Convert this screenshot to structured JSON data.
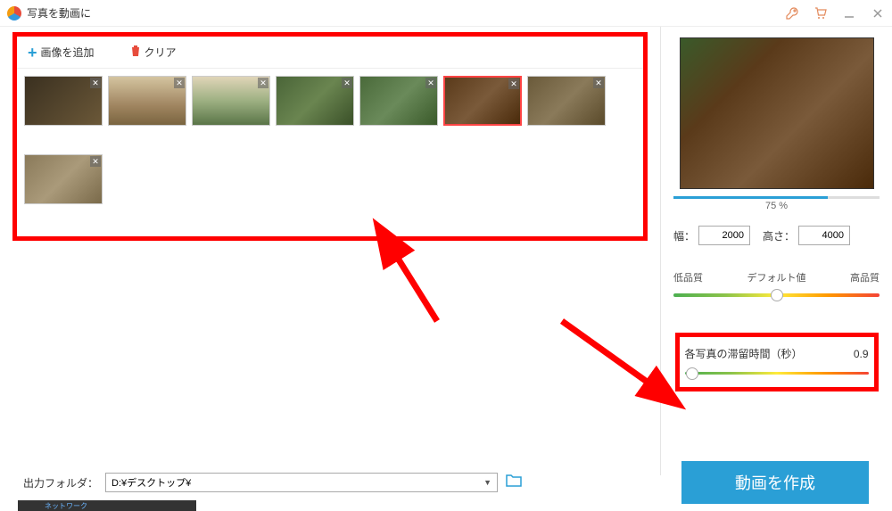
{
  "app_title": "写真を動画に",
  "toolbar": {
    "add_label": "画像を追加",
    "clear_label": "クリア"
  },
  "thumbnails": [
    {
      "id": 1
    },
    {
      "id": 2
    },
    {
      "id": 3
    },
    {
      "id": 4
    },
    {
      "id": 5
    },
    {
      "id": 6,
      "selected": true
    },
    {
      "id": 7
    },
    {
      "id": 8
    }
  ],
  "preview": {
    "progress_percent": 75,
    "progress_label": "75 %"
  },
  "dimensions": {
    "width_label": "幅：",
    "width_value": "2000",
    "height_label": "高さ：",
    "height_value": "4000"
  },
  "quality": {
    "low_label": "低品質",
    "default_label": "デフォルト値",
    "high_label": "高品質",
    "position_pct": 50
  },
  "dwell": {
    "label": "各写真の滞留時間（秒）",
    "value": "0.9",
    "position_pct": 4
  },
  "output": {
    "label": "出力フォルダ：",
    "path": "D:¥デスクトップ¥"
  },
  "create_button": "動画を作成",
  "taskbar_item": "ネットワーク"
}
